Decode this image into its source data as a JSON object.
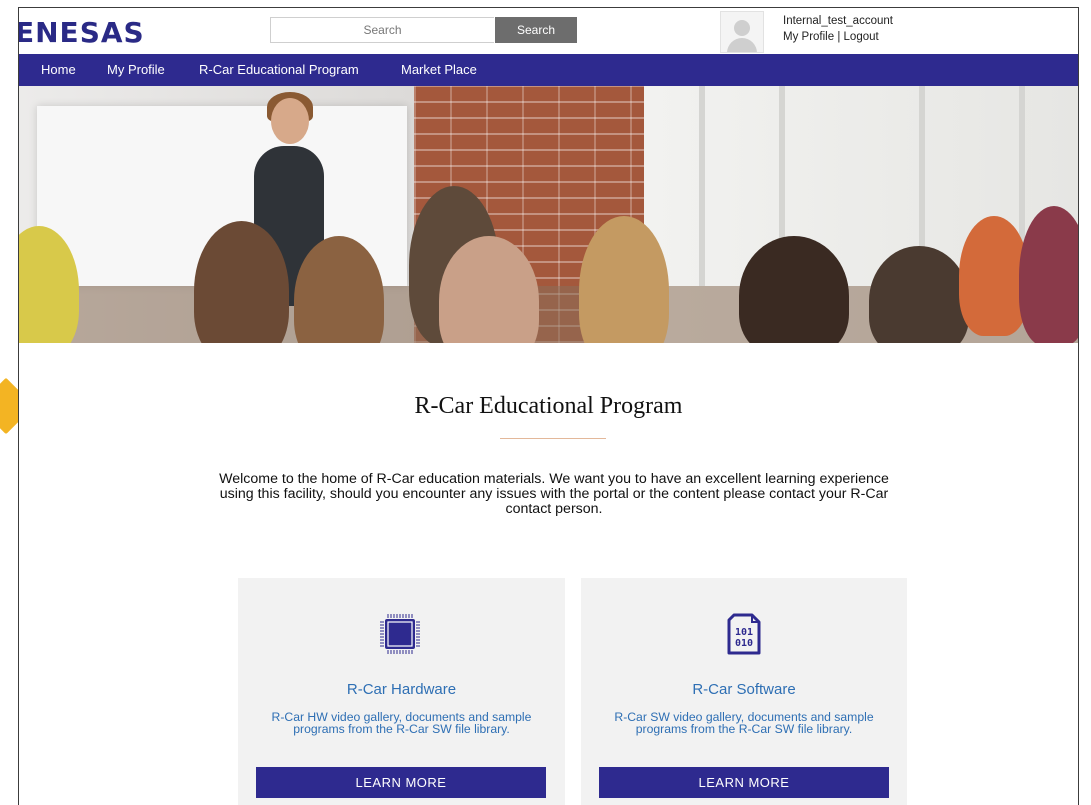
{
  "header": {
    "logo_text": "ENESAS",
    "search": {
      "placeholder": "Search",
      "button_label": "Search"
    },
    "user": {
      "name": "Internal_test_account",
      "my_profile_link": "My Profile",
      "separator": "|",
      "logout_link": "Logout"
    }
  },
  "nav": {
    "items": [
      {
        "label": "Home"
      },
      {
        "label": "My Profile"
      },
      {
        "label": "R-Car Educational Program"
      },
      {
        "label": "Market Place"
      }
    ]
  },
  "hero": {
    "icon": "classroom-photo"
  },
  "main": {
    "title": "R-Car Educational Program",
    "welcome_text": "Welcome to the home of R-Car education materials. We want you to have an excellent learning experience using this facility, should you encounter any issues with the portal or the content please contact your R-Car contact person."
  },
  "cards": [
    {
      "icon": "chip-icon",
      "title": "R-Car Hardware",
      "description": "R-Car HW video gallery, documents and sample programs from the R-Car SW file library.",
      "button_label": "LEARN MORE"
    },
    {
      "icon": "binary-file-icon",
      "title": "R-Car Software",
      "description": "R-Car SW video gallery, documents and sample programs from the R-Car SW file library.",
      "button_label": "LEARN MORE"
    }
  ],
  "colors": {
    "brand_navy": "#2e2a8f",
    "link_blue": "#2e6fb4",
    "callout_arrow": "#f3b423"
  }
}
